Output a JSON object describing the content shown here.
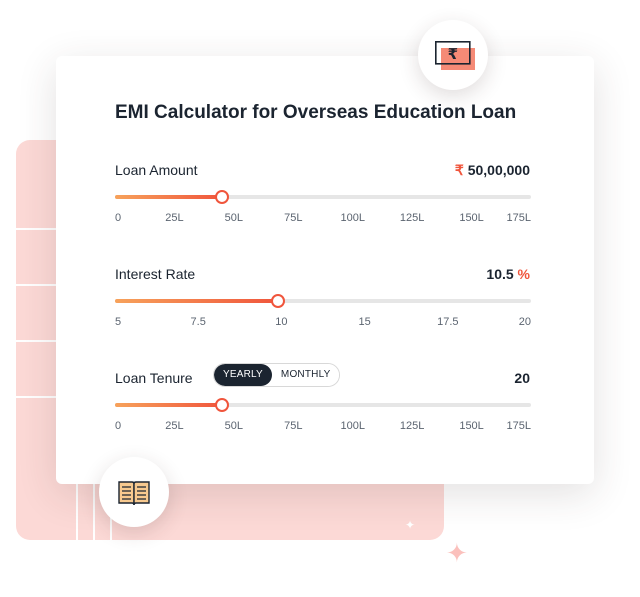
{
  "title": "EMI Calculator for Overseas Education Loan",
  "colors": {
    "accent": "#f0553c",
    "accent_start": "#f7a25b",
    "dark": "#1b2430",
    "panel": "#fcd9d6"
  },
  "icons": {
    "top_badge": "rupee-note-icon",
    "bottom_badge": "open-book-icon"
  },
  "loan_amount": {
    "label": "Loan Amount",
    "currency": "₹",
    "value": "50,00,000",
    "slider_fraction": 0.2581,
    "ticks": [
      "0",
      "25L",
      "50L",
      "75L",
      "100L",
      "125L",
      "150L",
      "175L"
    ]
  },
  "interest_rate": {
    "label": "Interest Rate",
    "value": "10.5",
    "unit": "%",
    "slider_fraction": 0.3918,
    "ticks": [
      "5",
      "7.5",
      "10",
      "15",
      "17.5",
      "20"
    ]
  },
  "loan_tenure": {
    "label": "Loan Tenure",
    "toggle": {
      "options": [
        "YEARLY",
        "MONTHLY"
      ],
      "selected": "YEARLY"
    },
    "value": "20",
    "slider_fraction": 0.2581,
    "ticks": [
      "0",
      "25L",
      "50L",
      "75L",
      "100L",
      "125L",
      "150L",
      "175L"
    ]
  }
}
